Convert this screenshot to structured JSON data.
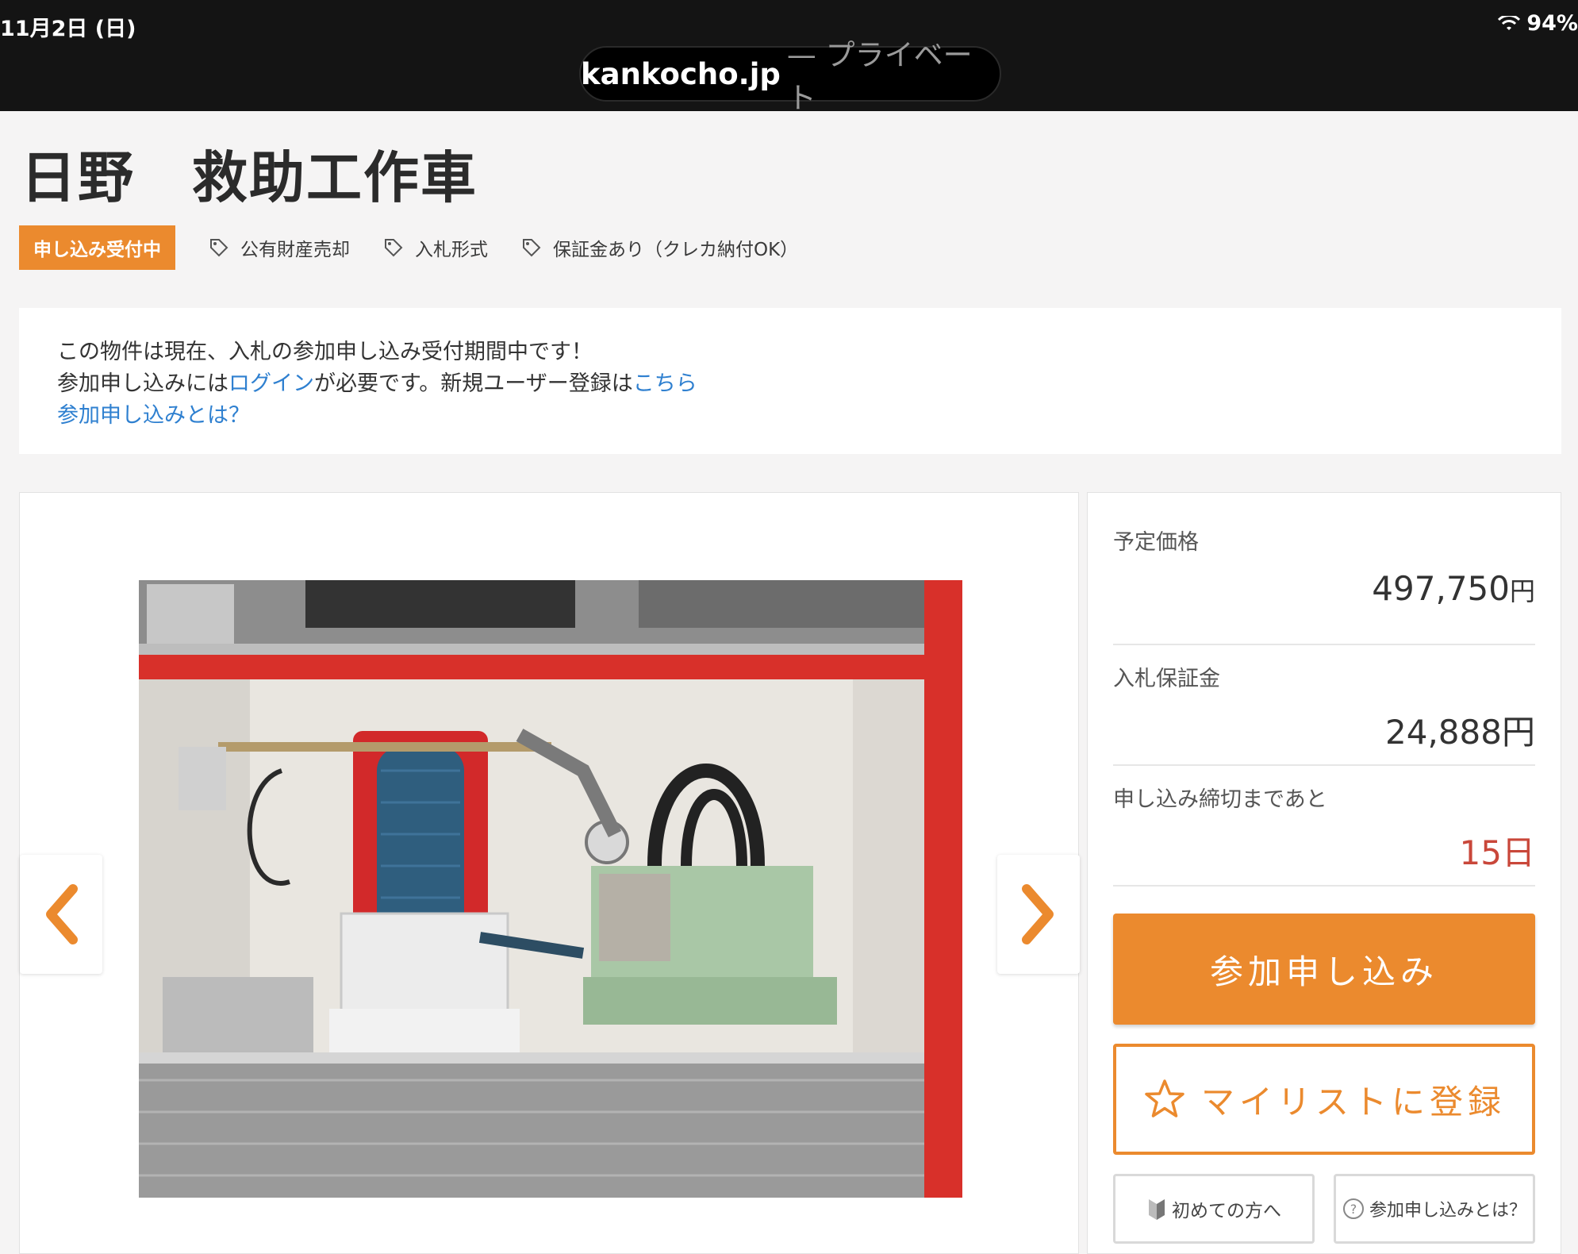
{
  "status_bar": {
    "date": "11月2日 (日)",
    "battery": "94%"
  },
  "address_bar": {
    "host": "kankocho.jp",
    "mode": "— プライベート"
  },
  "title": "日野　救助工作車",
  "tags": {
    "status": "申し込み受付中",
    "items": [
      "公有財産売却",
      "入札形式",
      "保証金あり（クレカ納付OK）"
    ]
  },
  "notice": {
    "line1": "この物件は現在、入札の参加申し込み受付期間中です！",
    "line2_pre": "参加申し込みには",
    "login_link": "ログイン",
    "line2_mid": "が必要です。新規ユーザー登録は",
    "register_link": "こちら",
    "help_link": "参加申し込みとは？"
  },
  "info": {
    "price_label": "予定価格",
    "price_value": "497,750",
    "deposit_label": "入札保証金",
    "deposit_value": "24,888",
    "deadline_label": "申し込み締切まであと",
    "deadline_value": "15日",
    "yen": "円"
  },
  "buttons": {
    "apply": "参加申し込み",
    "mylist": "マイリストに登録",
    "beginner": "初めての方へ",
    "about": "参加申し込みとは？"
  },
  "colors": {
    "accent": "#eb8a2e",
    "link": "#2f80d0",
    "deadline": "#c9473a"
  }
}
